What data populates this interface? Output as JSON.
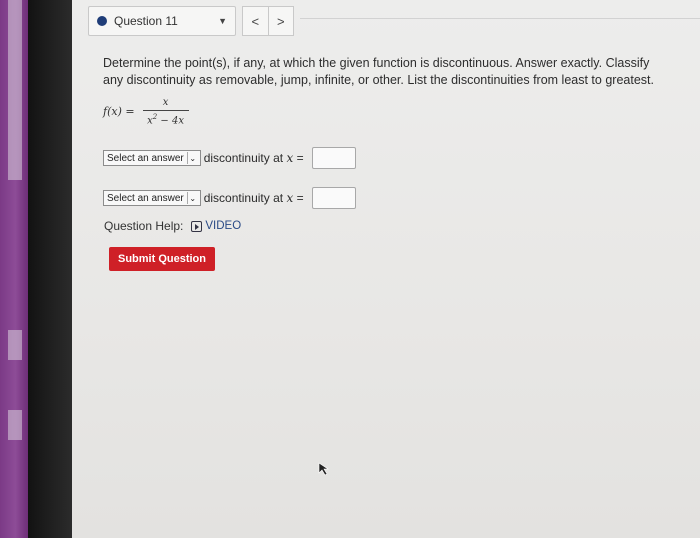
{
  "question_nav": {
    "label": "Question 11",
    "prev_icon": "<",
    "next_icon": ">",
    "dot_color": "#1f3d78"
  },
  "prompt": "Determine the point(s), if any, at which the given function is discontinuous. Answer exactly. Classify any discontinuity as removable, jump, infinite, or other. List the discontinuities from least to greatest.",
  "formula": {
    "lhs": "f(x) =",
    "numerator": "x",
    "denominator_base": "x",
    "denominator_exp": "2",
    "denominator_rest": " − 4x"
  },
  "answers": [
    {
      "select_value": "Select an answer",
      "text": "discontinuity at",
      "var": "x",
      "eq": "=",
      "value": ""
    },
    {
      "select_value": "Select an answer",
      "text": "discontinuity at",
      "var": "x",
      "eq": "=",
      "value": ""
    }
  ],
  "help": {
    "label": "Question Help:",
    "video_label": "VIDEO"
  },
  "submit_label": "Submit Question",
  "colors": {
    "accent_red": "#cf2027",
    "bezel_purple": "#7b3a86"
  }
}
